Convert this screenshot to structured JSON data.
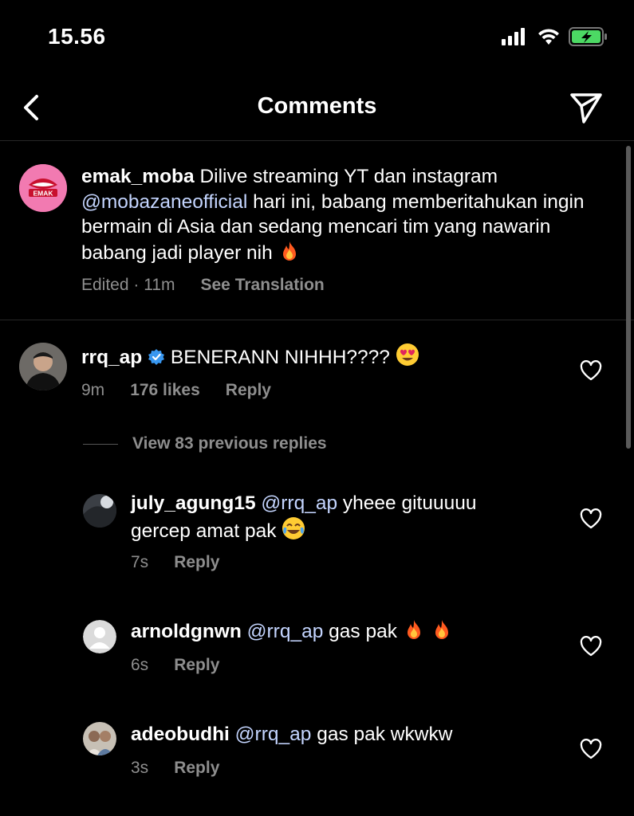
{
  "status": {
    "time": "15.56"
  },
  "header": {
    "title": "Comments"
  },
  "caption": {
    "username": "emak_moba",
    "text_1": "Dilive streaming YT dan instagram",
    "mention": "@mobazaneofficial",
    "text_2": "hari ini, babang memberitahukan ingin bermain di Asia dan sedang mencari tim yang nawarin babang jadi player nih",
    "emoji": "fire",
    "edited_label": "Edited · 11m",
    "see_translation": "See Translation",
    "avatar_text": "EMAK"
  },
  "comments": [
    {
      "username": "rrq_ap",
      "verified": true,
      "text": "BENERANN NIHHH????",
      "emoji": "heart-eyes",
      "time": "9m",
      "likes": "176 likes",
      "reply": "Reply"
    }
  ],
  "view_replies": "View 83 previous replies",
  "replies": [
    {
      "username": "july_agung15",
      "mention": "@rrq_ap",
      "text": "yheee gituuuuu gercep amat pak",
      "emoji": "joy",
      "time": "7s",
      "reply": "Reply"
    },
    {
      "username": "arnoldgnwn",
      "mention": "@rrq_ap",
      "text": "gas pak",
      "emoji": "fire fire",
      "time": "6s",
      "reply": "Reply"
    },
    {
      "username": "adeobudhi",
      "mention": "@rrq_ap",
      "text": "gas pak wkwkw",
      "time": "3s",
      "reply": "Reply"
    }
  ],
  "colors": {
    "background": "#000000",
    "mention": "#c4d5ff",
    "muted": "#8e8e8e",
    "verified": "#3897f0",
    "battery": "#4cd964"
  }
}
